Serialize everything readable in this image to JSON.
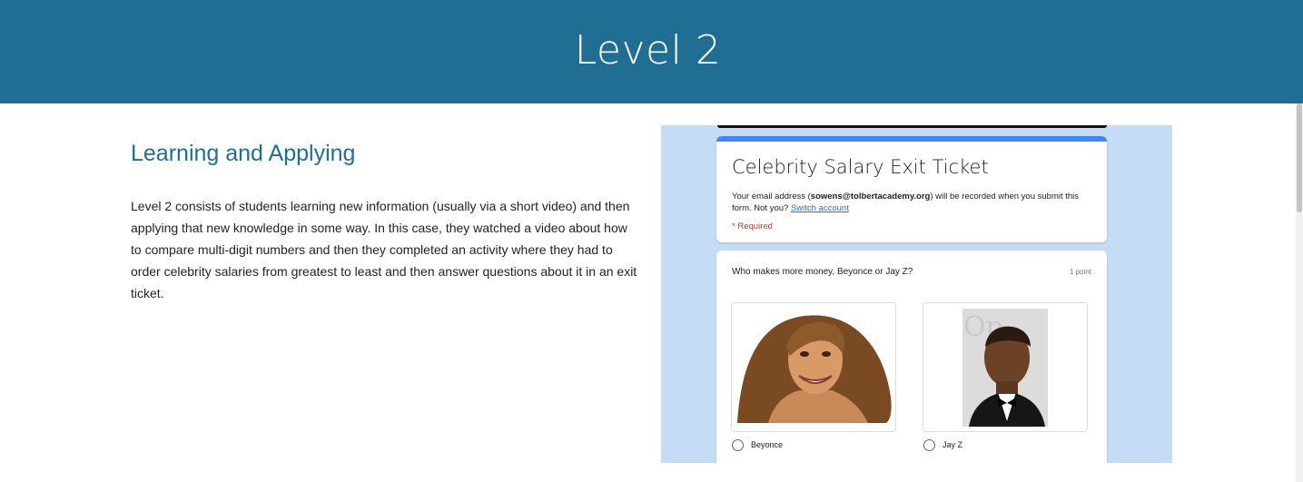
{
  "header": {
    "title": "Level 2",
    "bg": "#206e94"
  },
  "section": {
    "heading": "Learning and Applying",
    "body": "Level 2 consists of students learning new information (usually via a short video) and then applying that new knowledge in some way. In this case, they watched a video about how to compare multi-digit numbers and then they completed an activity where they had to order celebrity salaries from greatest to least and then answer questions about it in an exit ticket."
  },
  "form": {
    "title": "Celebrity Salary Exit Ticket",
    "email_prefix": "Your email address (",
    "email": "sowens@tolbertacademy.org",
    "email_suffix": ") will be recorded when you submit this form. Not you?",
    "switch_account": "Switch account",
    "required": "* Required",
    "question": "Who makes more money, Beyonce or Jay Z?",
    "points": "1 point",
    "options": [
      {
        "label": "Beyonce",
        "image": "photo-of-beyonce"
      },
      {
        "label": "Jay Z",
        "image": "photo-of-jay-z"
      }
    ],
    "accent": "#4285f4",
    "background": "#c4dcf4"
  }
}
